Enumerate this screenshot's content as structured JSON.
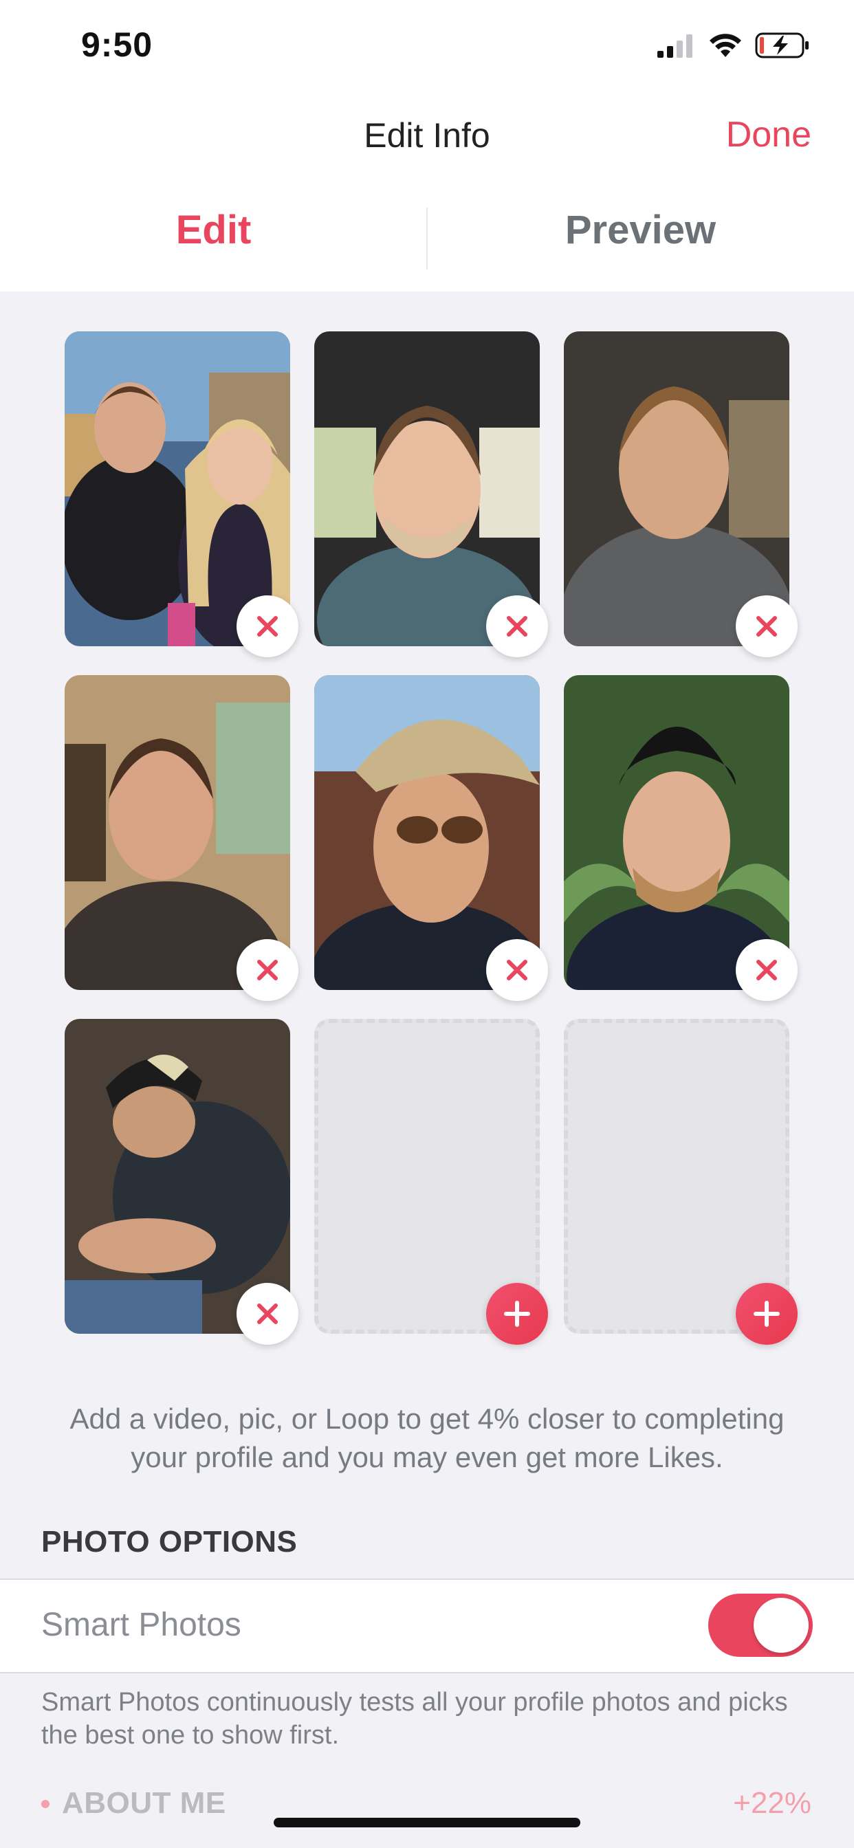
{
  "status_bar": {
    "time": "9:50",
    "icons": [
      "cellular-signal-icon",
      "wifi-icon",
      "battery-charging-icon"
    ]
  },
  "nav": {
    "title": "Edit Info",
    "done_label": "Done"
  },
  "tabs": [
    {
      "label": "Edit",
      "active": true
    },
    {
      "label": "Preview",
      "active": false
    }
  ],
  "photos": [
    {
      "filled": true,
      "action": "remove"
    },
    {
      "filled": true,
      "action": "remove"
    },
    {
      "filled": true,
      "action": "remove"
    },
    {
      "filled": true,
      "action": "remove"
    },
    {
      "filled": true,
      "action": "remove"
    },
    {
      "filled": true,
      "action": "remove"
    },
    {
      "filled": true,
      "action": "remove"
    },
    {
      "filled": false,
      "action": "add"
    },
    {
      "filled": false,
      "action": "add"
    }
  ],
  "helper_text": "Add a video, pic, or Loop to get 4% closer to completing your profile and you may even get more Likes.",
  "photo_options": {
    "header": "PHOTO OPTIONS",
    "smart_photos_label": "Smart Photos",
    "smart_photos_enabled": true,
    "smart_photos_description": "Smart Photos continuously tests all your profile photos and picks the best one to show first."
  },
  "about_me": {
    "header": "ABOUT ME",
    "percent": "+22%"
  },
  "colors": {
    "accent": "#e9455f",
    "tab_inactive": "#6c7077",
    "background": "#f2f2f6"
  }
}
